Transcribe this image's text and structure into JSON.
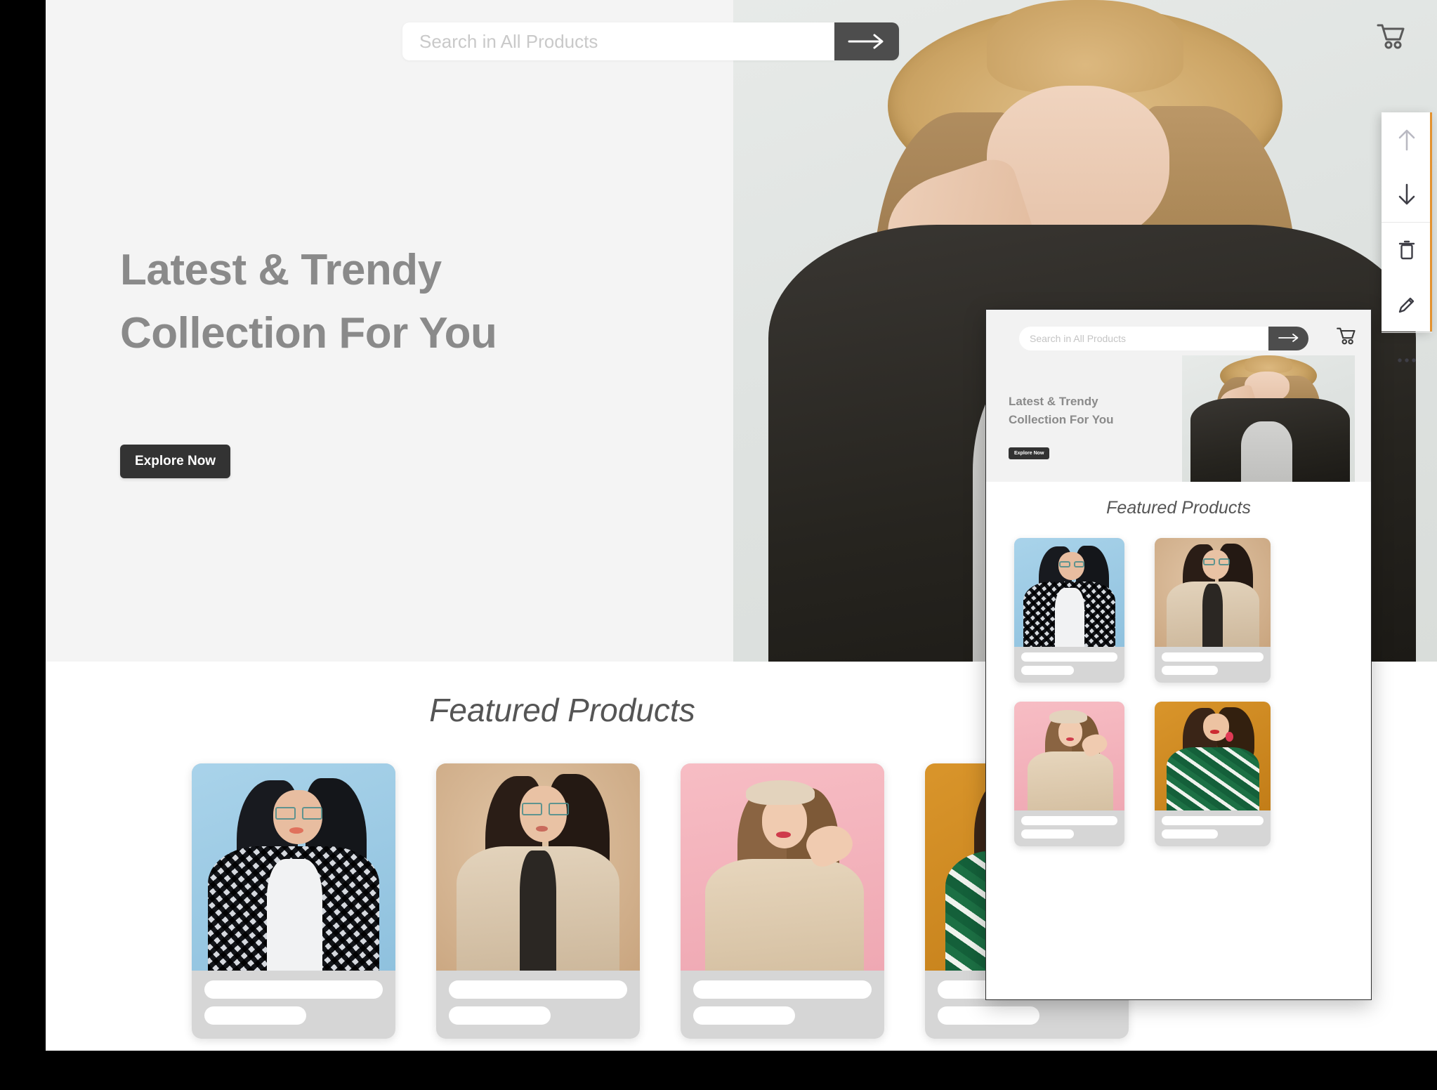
{
  "app": {
    "accent_color": "#e3922f",
    "canvas_bg": "#ffffff",
    "page_bg": "#f4f4f4"
  },
  "desktop": {
    "search": {
      "placeholder": "Search in All Products",
      "value": "",
      "submit_icon": "arrow-right-icon"
    },
    "cart_icon": "shopping-cart-icon",
    "hero": {
      "title_line1": "Latest & Trendy",
      "title_line2": "Collection For You",
      "cta_label": "Explore Now",
      "image_alt": "woman-in-straw-hat"
    },
    "featured": {
      "heading": "Featured Products",
      "products": [
        {
          "image_alt": "model-blue-background-plaid-shirt",
          "bg": "#9ecae5"
        },
        {
          "image_alt": "model-beige-background-trench-coat",
          "bg": "#d8bb9b"
        },
        {
          "image_alt": "model-pink-background-beret",
          "bg": "#f3b3bc"
        },
        {
          "image_alt": "model-orange-background-green-dress",
          "bg": "#cf8a22"
        }
      ]
    }
  },
  "mobile_preview": {
    "search": {
      "placeholder": "Search in All Products",
      "value": "",
      "submit_icon": "arrow-right-icon"
    },
    "cart_icon": "shopping-cart-icon",
    "hero": {
      "title_line1": "Latest & Trendy",
      "title_line2": "Collection For You",
      "cta_label": "Explore Now",
      "image_alt": "woman-in-straw-hat"
    },
    "featured": {
      "heading": "Featured Products",
      "products": [
        {
          "image_alt": "model-blue-background-plaid-shirt",
          "bg": "#9ecae5"
        },
        {
          "image_alt": "model-beige-background-trench-coat",
          "bg": "#d8bb9b"
        },
        {
          "image_alt": "model-pink-background-beret",
          "bg": "#f3b3bc"
        },
        {
          "image_alt": "model-orange-background-green-dress",
          "bg": "#cf8a22"
        }
      ]
    }
  },
  "toolbar": {
    "accent_color": "#e3922f",
    "buttons": [
      {
        "name": "move-up-button",
        "icon": "arrow-up-icon",
        "state": "disabled"
      },
      {
        "name": "move-down-button",
        "icon": "arrow-down-icon",
        "state": "enabled"
      },
      {
        "name": "delete-button",
        "icon": "trash-icon",
        "state": "enabled"
      },
      {
        "name": "edit-button",
        "icon": "pencil-icon",
        "state": "enabled"
      },
      {
        "name": "more-button",
        "icon": "ellipsis-icon",
        "state": "enabled"
      }
    ]
  }
}
